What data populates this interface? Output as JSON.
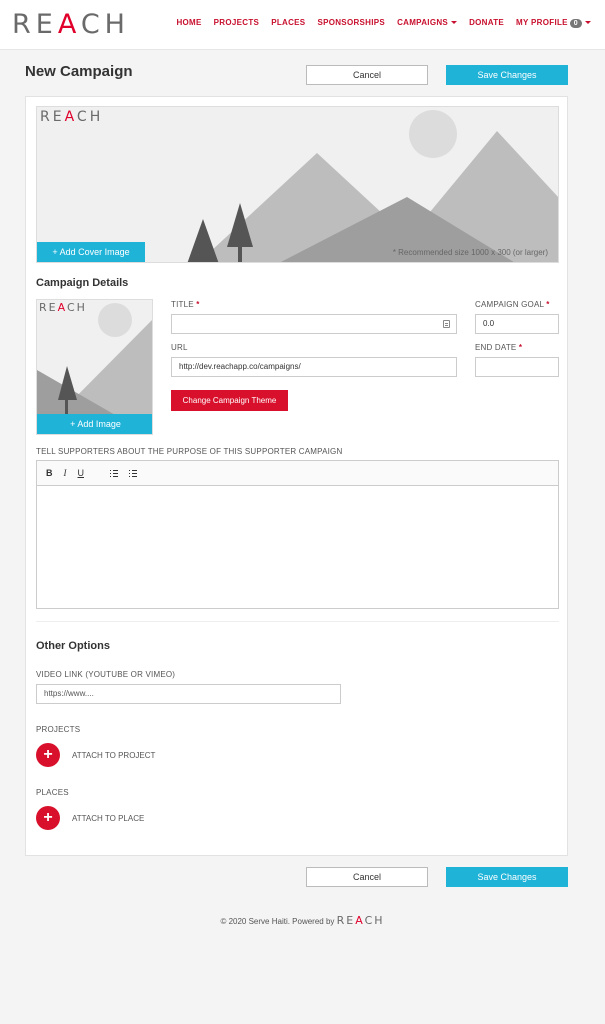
{
  "header": {
    "logo": {
      "r": "RE",
      "a": "A",
      "rest": "CH"
    },
    "nav": [
      "HOME",
      "PROJECTS",
      "PLACES",
      "SPONSORSHIPS",
      "CAMPAIGNS",
      "DONATE",
      "MY PROFILE"
    ],
    "profile_badge": "0"
  },
  "page": {
    "title": "New Campaign",
    "cancel_label": "Cancel",
    "save_label": "Save Changes"
  },
  "cover": {
    "add_label": "+ Add Cover Image",
    "note": "* Recommended size 1000 x 300 (or larger)"
  },
  "details": {
    "heading": "Campaign Details",
    "add_image_label": "+ Add Image",
    "title_label": "TITLE",
    "title_value": "",
    "goal_label": "CAMPAIGN GOAL",
    "goal_value": "0.0",
    "url_label": "URL",
    "url_value": "http://dev.reachapp.co/campaigns/",
    "end_date_label": "END DATE",
    "end_date_value": "",
    "required_mark": "*",
    "theme_button": "Change Campaign Theme"
  },
  "editor": {
    "label": "TELL SUPPORTERS ABOUT THE PURPOSE OF THIS SUPPORTER CAMPAIGN",
    "bold": "B",
    "italic": "I",
    "underline": "U"
  },
  "options": {
    "heading": "Other Options",
    "video_label": "VIDEO LINK (YOUTUBE OR VIMEO)",
    "video_placeholder": "https://www....",
    "projects_label": "PROJECTS",
    "attach_project": "ATTACH TO PROJECT",
    "places_label": "PLACES",
    "attach_place": "ATTACH TO PLACE",
    "plus": "+"
  },
  "footer": {
    "text": "© 2020 Serve Haiti. Powered by"
  },
  "colors": {
    "brand_red": "#d8102b",
    "accent_cyan": "#1fb3d8",
    "nav_red": "#c8102e"
  }
}
